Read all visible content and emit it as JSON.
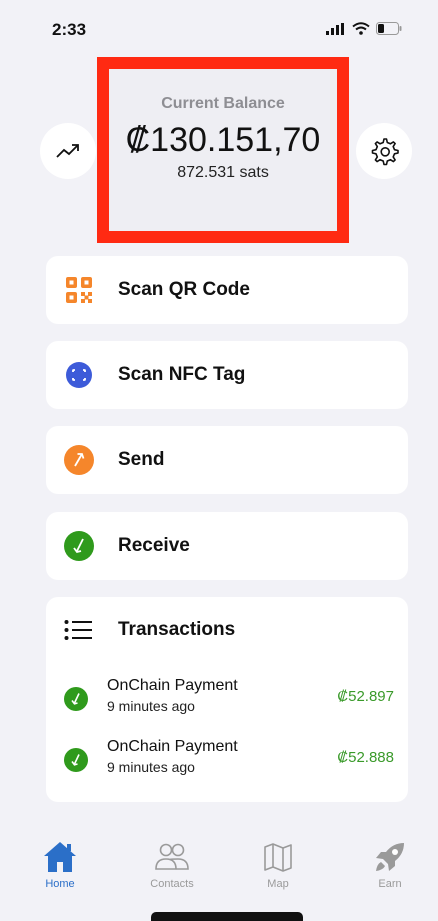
{
  "status_bar": {
    "time": "2:33"
  },
  "balance": {
    "label": "Current Balance",
    "value": "₡130.151,70",
    "sats": "872.531 sats"
  },
  "actions": [
    {
      "label": "Scan QR Code",
      "icon": "qr-code-icon",
      "color": "#f5862b"
    },
    {
      "label": "Scan NFC Tag",
      "icon": "nfc-icon",
      "color": "#3d5bd9"
    },
    {
      "label": "Send",
      "icon": "send-icon",
      "color": "#f5862b"
    },
    {
      "label": "Receive",
      "icon": "receive-icon",
      "color": "#2f9a1c"
    }
  ],
  "transactions": {
    "title": "Transactions",
    "items": [
      {
        "name": "OnChain Payment",
        "time": "9 minutes ago",
        "amount": "₡52.897"
      },
      {
        "name": "OnChain Payment",
        "time": "9 minutes ago",
        "amount": "₡52.888"
      }
    ]
  },
  "tabs": [
    {
      "label": "Home",
      "icon": "home-icon",
      "active": true
    },
    {
      "label": "Contacts",
      "icon": "contacts-icon",
      "active": false
    },
    {
      "label": "Map",
      "icon": "map-icon",
      "active": false
    },
    {
      "label": "Earn",
      "icon": "rocket-icon",
      "active": false
    }
  ],
  "colors": {
    "accent": "#2b6fc8",
    "highlight_border": "#ff2a12",
    "positive_amount": "#3a9a2a"
  }
}
